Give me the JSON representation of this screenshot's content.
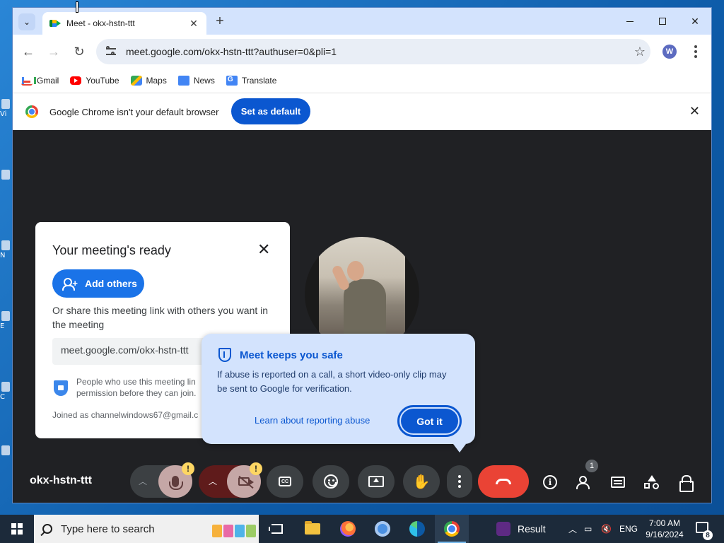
{
  "desktop": {
    "icons": [
      {
        "label": "Vi"
      },
      {
        "label": ""
      },
      {
        "label": "N"
      },
      {
        "label": "E"
      },
      {
        "label": "C"
      },
      {
        "label": ""
      }
    ]
  },
  "browser": {
    "tab": {
      "title": "Meet - okx-hstn-ttt",
      "close": "✕"
    },
    "new_tab": "+",
    "window_controls": {
      "close": "✕"
    },
    "address": {
      "url": "meet.google.com/okx-hstn-ttt?authuser=0&pli=1"
    },
    "profile_initial": "W",
    "bookmarks": [
      {
        "label": "Gmail",
        "icon": "gmail-icon"
      },
      {
        "label": "YouTube",
        "icon": "youtube-icon"
      },
      {
        "label": "Maps",
        "icon": "maps-icon"
      },
      {
        "label": "News",
        "icon": "news-icon"
      },
      {
        "label": "Translate",
        "icon": "translate-icon"
      }
    ],
    "infobar": {
      "message": "Google Chrome isn't your default browser",
      "button": "Set as default",
      "close": "✕"
    }
  },
  "meet": {
    "ready_dialog": {
      "title": "Your meeting's ready",
      "close": "✕",
      "add_button": "Add others",
      "share_text": "Or share this meeting link with others you want in the meeting",
      "link": "meet.google.com/okx-hstn-ttt",
      "permission_line1": "People who use this meeting lin",
      "permission_line2": "permission before they can join.",
      "joined_as": "Joined as channelwindows67@gmail.c"
    },
    "safe_popup": {
      "title": "Meet keeps you safe",
      "description": "If abuse is reported on a call, a short video-only clip may be sent to Google for verification.",
      "learn_link": "Learn about reporting abuse",
      "got_it": "Got it"
    },
    "meeting_code": "okx-hstn-ttt",
    "controls": {
      "mic_warning": "!",
      "cam_warning": "!",
      "cc_label": "CC",
      "people_count": "1"
    },
    "colors": {
      "end_call": "#ea4335",
      "primary": "#1a73e8",
      "popup_bg": "#d3e3fd"
    }
  },
  "taskbar": {
    "search_placeholder": "Type here to search",
    "result_app": "Result",
    "language": "ENG",
    "time": "7:00 AM",
    "date": "9/16/2024",
    "notification_count": "8"
  }
}
